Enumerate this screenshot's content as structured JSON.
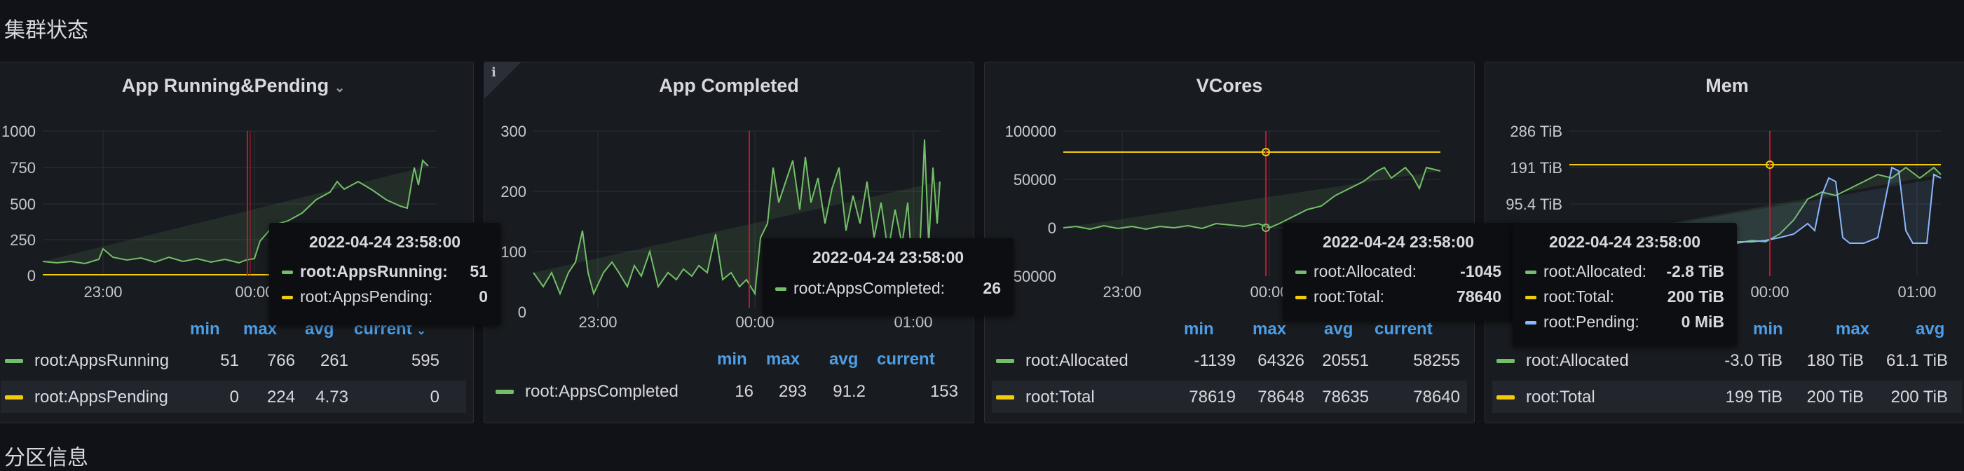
{
  "page": {
    "row_title": "集群状态",
    "row2_title": "分区信息"
  },
  "colors": {
    "green": "#73bf69",
    "yellow": "#f2cc0c",
    "cyan": "#8ab8ff",
    "blue": "#4d9ee6",
    "red": "#c4162a"
  },
  "panels": [
    {
      "title": "App Running&Pending",
      "has_menu": true,
      "y_ticks": [
        "1000",
        "750",
        "500",
        "250",
        "0"
      ],
      "x_ticks": [
        "23:00",
        "00:00"
      ],
      "legend_headers": [
        "min",
        "max",
        "avg",
        "current"
      ],
      "legend_sort_icon": "chevron-down-icon",
      "series": [
        {
          "name": "root:AppsRunning",
          "color": "#73bf69",
          "min": "51",
          "max": "766",
          "avg": "261",
          "current": "595"
        },
        {
          "name": "root:AppsPending",
          "color": "#f2cc0c",
          "min": "0",
          "max": "224",
          "avg": "4.73",
          "current": "0"
        }
      ],
      "tooltip": {
        "time": "2022-04-24 23:58:00",
        "rows": [
          {
            "name": "root:AppsRunning:",
            "value": "51",
            "color": "#73bf69",
            "bold": true
          },
          {
            "name": "root:AppsPending:",
            "value": "0",
            "color": "#f2cc0c",
            "bold": false
          }
        ]
      }
    },
    {
      "title": "App Completed",
      "has_info": true,
      "info_icon": "info-icon",
      "y_ticks": [
        "300",
        "200",
        "100",
        "0"
      ],
      "x_ticks": [
        "23:00",
        "00:00",
        "01:00"
      ],
      "legend_headers": [
        "min",
        "max",
        "avg",
        "current"
      ],
      "series": [
        {
          "name": "root:AppsCompleted",
          "color": "#73bf69",
          "min": "16",
          "max": "293",
          "avg": "91.2",
          "current": "153"
        }
      ],
      "tooltip": {
        "time": "2022-04-24 23:58:00",
        "rows": [
          {
            "name": "root:AppsCompleted:",
            "value": "26",
            "color": "#73bf69",
            "bold": false
          }
        ]
      }
    },
    {
      "title": "VCores",
      "y_ticks": [
        "100000",
        "50000",
        "0",
        "-50000"
      ],
      "x_ticks": [
        "23:00",
        "00:00"
      ],
      "legend_headers": [
        "min",
        "max",
        "avg",
        "current"
      ],
      "series": [
        {
          "name": "root:Allocated",
          "color": "#73bf69",
          "min": "-1139",
          "max": "64326",
          "avg": "20551",
          "current": "58255"
        },
        {
          "name": "root:Total",
          "color": "#f2cc0c",
          "min": "78619",
          "max": "78648",
          "avg": "78635",
          "current": "78640"
        }
      ],
      "tooltip": {
        "time": "2022-04-24 23:58:00",
        "rows": [
          {
            "name": "root:Allocated:",
            "value": "-1045",
            "color": "#73bf69",
            "bold": false
          },
          {
            "name": "root:Total:",
            "value": "78640",
            "color": "#f2cc0c",
            "bold": false
          }
        ]
      }
    },
    {
      "title": "Mem",
      "y_ticks": [
        "286 TiB",
        "191 TiB",
        "95.4 TiB"
      ],
      "x_ticks": [
        "00:00",
        "01:00"
      ],
      "legend_headers": [
        "min",
        "max",
        "avg"
      ],
      "series": [
        {
          "name": "root:Allocated",
          "color": "#73bf69",
          "min": "-3.0 TiB",
          "max": "180 TiB",
          "avg": "61.1 TiB"
        },
        {
          "name": "root:Total",
          "color": "#f2cc0c",
          "min": "199 TiB",
          "max": "200 TiB",
          "avg": "200 TiB"
        }
      ],
      "tooltip": {
        "time": "2022-04-24 23:58:00",
        "rows": [
          {
            "name": "root:Allocated:",
            "value": "-2.8 TiB",
            "color": "#73bf69",
            "bold": false
          },
          {
            "name": "root:Total:",
            "value": "200 TiB",
            "color": "#f2cc0c",
            "bold": false
          },
          {
            "name": "root:Pending:",
            "value": "0 MiB",
            "color": "#8ab8ff",
            "bold": false
          }
        ]
      }
    }
  ]
}
